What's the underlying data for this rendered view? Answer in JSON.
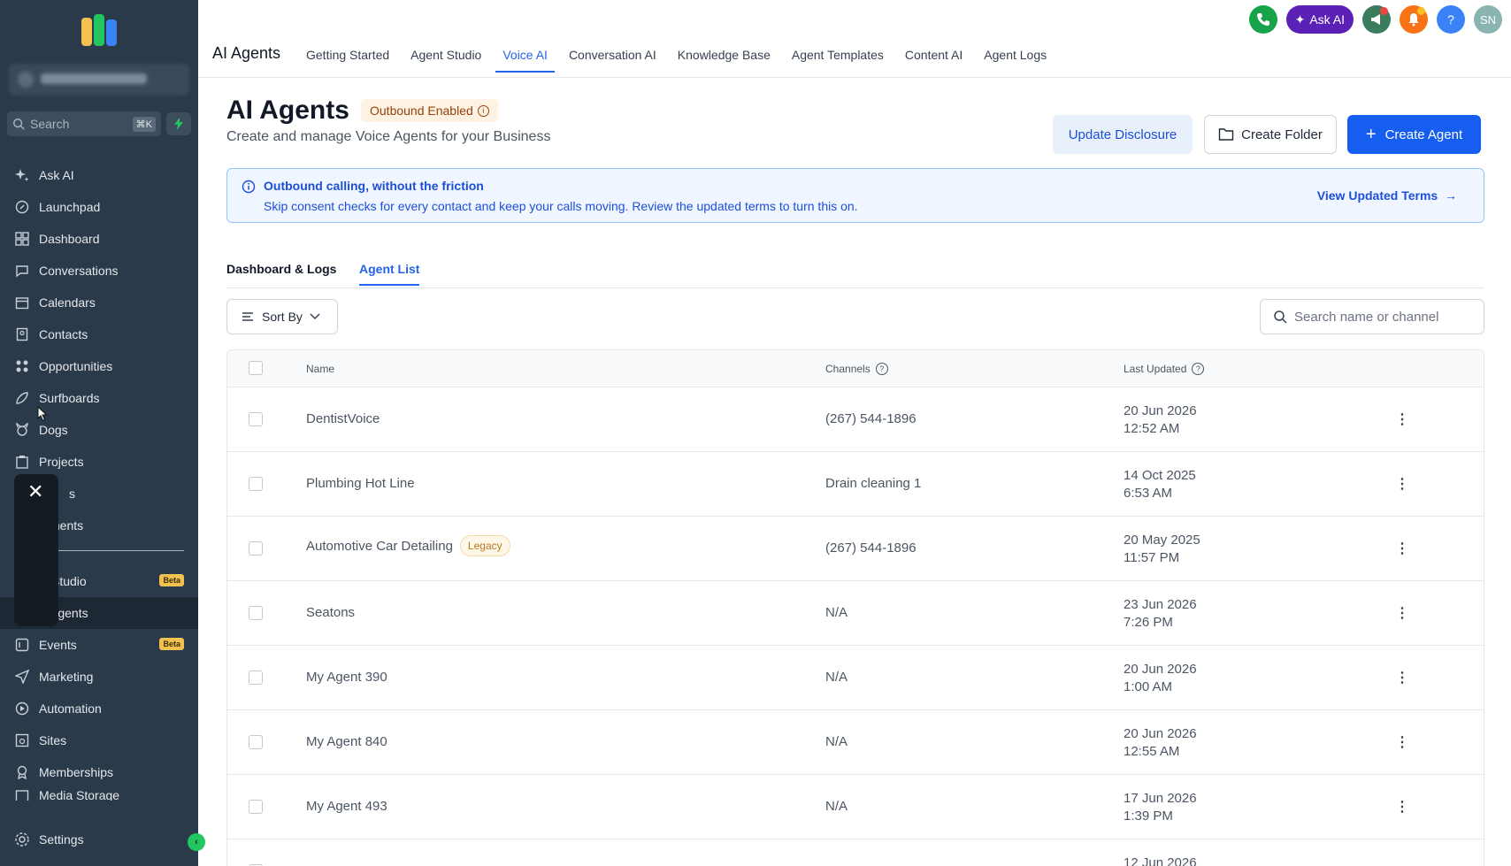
{
  "sidebar": {
    "search": {
      "placeholder": "Search",
      "shortcut": "⌘K"
    },
    "items": [
      {
        "label": "Ask AI",
        "icon": "sparkle-icon"
      },
      {
        "label": "Launchpad",
        "icon": "rocket-icon"
      },
      {
        "label": "Dashboard",
        "icon": "grid-icon"
      },
      {
        "label": "Conversations",
        "icon": "chat-icon"
      },
      {
        "label": "Calendars",
        "icon": "calendar-icon"
      },
      {
        "label": "Contacts",
        "icon": "contacts-icon"
      },
      {
        "label": "Opportunities",
        "icon": "funnel-icon"
      },
      {
        "label": "Surfboards",
        "icon": "surfboard-icon"
      },
      {
        "label": "Dogs",
        "icon": "dog-icon"
      },
      {
        "label": "Projects",
        "icon": "clipboard-icon"
      },
      {
        "label": "s",
        "icon": ""
      },
      {
        "label": "ments",
        "icon": ""
      }
    ],
    "items_after_divider": [
      {
        "label": "Studio",
        "icon": "",
        "badge": "Beta"
      },
      {
        "label": "Agents",
        "icon": "",
        "active": true
      },
      {
        "label": "Events",
        "icon": "events-icon",
        "badge": "Beta"
      },
      {
        "label": "Marketing",
        "icon": "send-icon"
      },
      {
        "label": "Automation",
        "icon": "automation-icon"
      },
      {
        "label": "Sites",
        "icon": "sites-icon"
      },
      {
        "label": "Memberships",
        "icon": "award-icon"
      },
      {
        "label": "Media Storage",
        "icon": "media-icon"
      }
    ],
    "settings_label": "Settings"
  },
  "topbar": {
    "app_title": "AI Agents",
    "tabs": [
      "Getting Started",
      "Agent Studio",
      "Voice AI",
      "Conversation AI",
      "Knowledge Base",
      "Agent Templates",
      "Content AI",
      "Agent Logs"
    ],
    "active_tab": "Voice AI",
    "ask_ai_label": "Ask AI",
    "avatar_initials": "SN"
  },
  "header": {
    "title": "AI Agents",
    "badge": "Outbound Enabled",
    "subtitle": "Create and manage Voice Agents for your Business",
    "update_disclosure": "Update Disclosure",
    "create_folder": "Create Folder",
    "create_agent": "Create Agent"
  },
  "banner": {
    "title": "Outbound calling, without the friction",
    "text": "Skip consent checks for every contact and keep your calls moving. Review the updated terms to turn this on.",
    "link": "View Updated Terms"
  },
  "subtabs": [
    "Dashboard & Logs",
    "Agent List"
  ],
  "controls": {
    "sort_by": "Sort By",
    "search_placeholder": "Search name or channel"
  },
  "table": {
    "columns": [
      "Name",
      "Channels",
      "Last Updated"
    ],
    "rows": [
      {
        "name": "DentistVoice",
        "tag": "",
        "channel": "(267) 544-1896",
        "date": "20 Jun 2026",
        "time": "12:52 AM"
      },
      {
        "name": "Plumbing Hot Line",
        "tag": "",
        "channel": "Drain cleaning 1",
        "date": "14 Oct 2025",
        "time": "6:53 AM"
      },
      {
        "name": "Automotive Car Detailing",
        "tag": "Legacy",
        "channel": "(267) 544-1896",
        "date": "20 May 2025",
        "time": "11:57 PM"
      },
      {
        "name": "Seatons",
        "tag": "",
        "channel": "N/A",
        "date": "23 Jun 2026",
        "time": "7:26 PM"
      },
      {
        "name": "My Agent 390",
        "tag": "",
        "channel": "N/A",
        "date": "20 Jun 2026",
        "time": "1:00 AM"
      },
      {
        "name": "My Agent 840",
        "tag": "",
        "channel": "N/A",
        "date": "20 Jun 2026",
        "time": "12:55 AM"
      },
      {
        "name": "My Agent 493",
        "tag": "",
        "channel": "N/A",
        "date": "17 Jun 2026",
        "time": "1:39 PM"
      },
      {
        "name": "",
        "tag": "",
        "channel": "",
        "date": "12 Jun 2026",
        "time": ""
      }
    ]
  },
  "colors": {
    "sidebar_bg": "#2b3a4a",
    "accent": "#155eef",
    "phone_green": "#16a34a",
    "ask_ai_purple": "#5b21b6",
    "notification_orange": "#f97316"
  }
}
